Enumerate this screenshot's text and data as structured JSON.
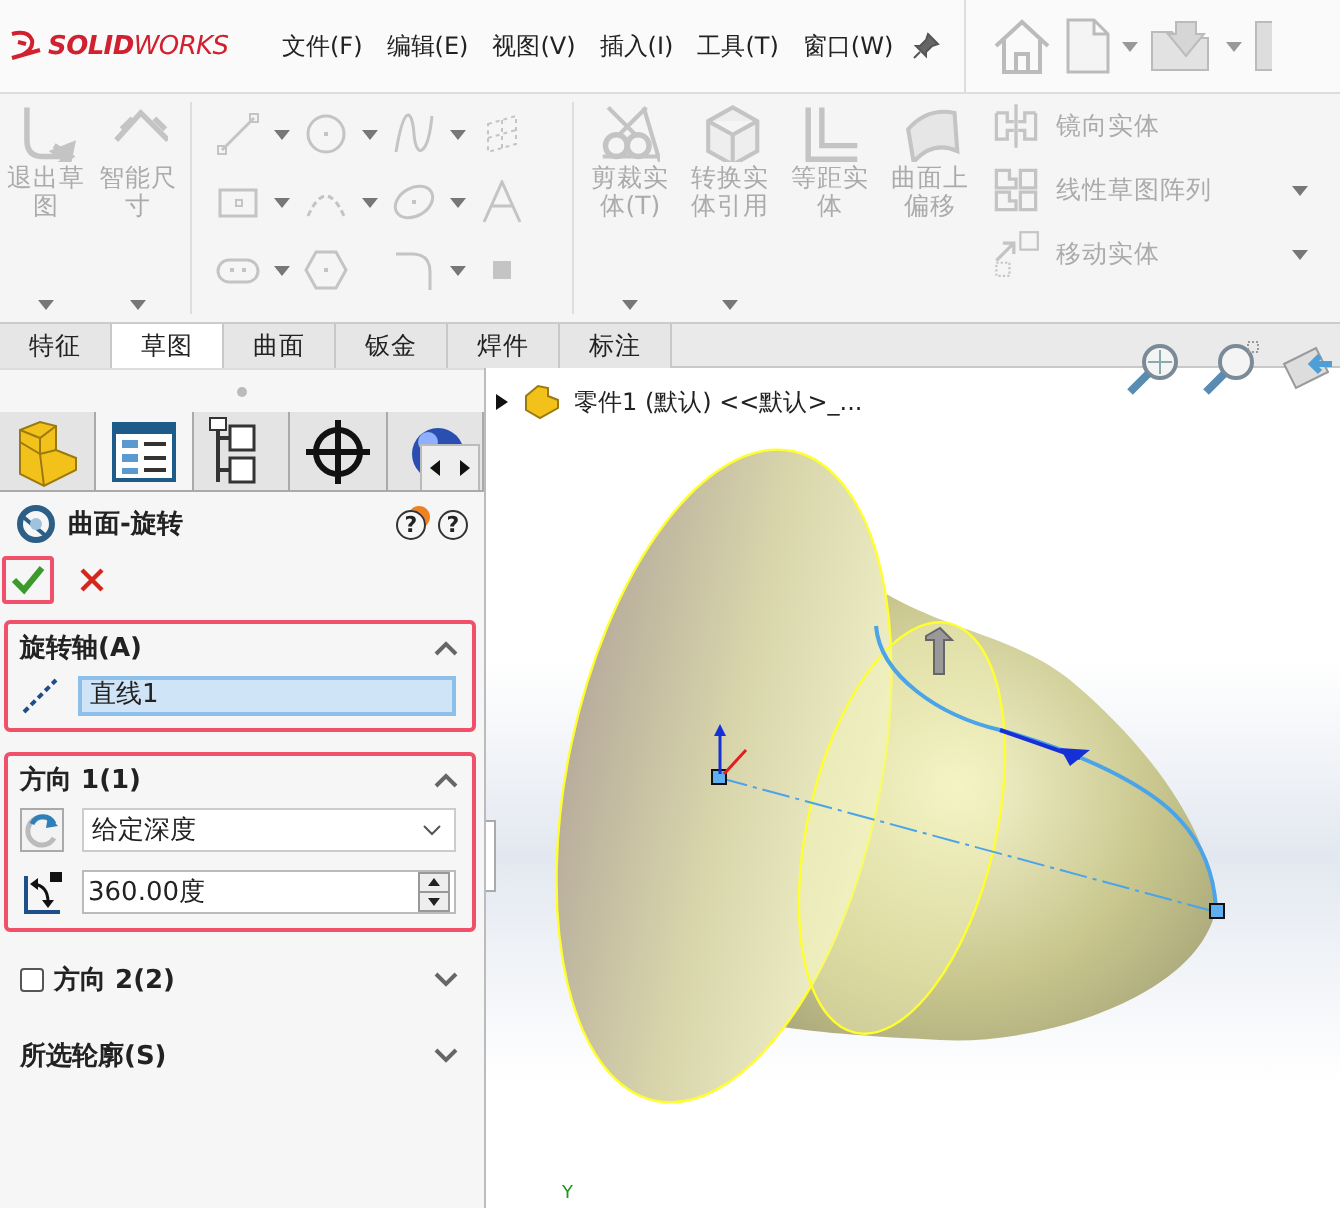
{
  "app": {
    "logo": "**SOLID**WORKS"
  },
  "menus": [
    {
      "label": "文件(F)"
    },
    {
      "label": "编辑(E)"
    },
    {
      "label": "视图(V)"
    },
    {
      "label": "插入(I)"
    },
    {
      "label": "工具(T)"
    },
    {
      "label": "窗口(W)"
    }
  ],
  "ribbon": {
    "large_buttons": [
      {
        "kind": "exit-sketch",
        "label": "退出草图",
        "disabled": true,
        "dropdown": true
      },
      {
        "kind": "smart-dimension",
        "label": "智能尺寸",
        "disabled": true,
        "dropdown": true
      }
    ],
    "sketch_tools": [
      {
        "kind": "line",
        "disabled": true,
        "dropdown": true
      },
      {
        "kind": "circle",
        "disabled": true,
        "dropdown": true
      },
      {
        "kind": "spline",
        "disabled": true,
        "dropdown": true
      },
      {
        "kind": "plane-grid",
        "disabled": true,
        "dropdown": false
      },
      {
        "kind": "rectangle",
        "disabled": true,
        "dropdown": true
      },
      {
        "kind": "arc",
        "disabled": true,
        "dropdown": true
      },
      {
        "kind": "ellipse",
        "disabled": true,
        "dropdown": true
      },
      {
        "kind": "text",
        "disabled": true,
        "dropdown": false
      },
      {
        "kind": "slot",
        "disabled": true,
        "dropdown": true
      },
      {
        "kind": "polygon",
        "disabled": true,
        "dropdown": false
      },
      {
        "kind": "fillet",
        "disabled": true,
        "dropdown": true
      },
      {
        "kind": "point",
        "disabled": true,
        "dropdown": false
      }
    ],
    "edit_buttons": [
      {
        "kind": "trim",
        "label": "剪裁实体(T)",
        "disabled": true,
        "dropdown": true
      },
      {
        "kind": "convert",
        "label": "转换实体引用",
        "disabled": true,
        "dropdown": true
      },
      {
        "kind": "offset",
        "label": "等距实体",
        "disabled": true,
        "dropdown": false
      },
      {
        "kind": "surface-offset",
        "label": "曲面上偏移",
        "disabled": true,
        "dropdown": false
      }
    ],
    "side_buttons": [
      {
        "kind": "mirror",
        "label": "镜向实体",
        "disabled": true,
        "dropdown": false
      },
      {
        "kind": "pattern",
        "label": "线性草图阵列",
        "disabled": true,
        "dropdown": true
      },
      {
        "kind": "move",
        "label": "移动实体",
        "disabled": true,
        "dropdown": true
      }
    ]
  },
  "command_tabs": [
    {
      "label": "特征",
      "selected": false
    },
    {
      "label": "草图",
      "selected": true
    },
    {
      "label": "曲面",
      "selected": false
    },
    {
      "label": "钣金",
      "selected": false
    },
    {
      "label": "焊件",
      "selected": false
    },
    {
      "label": "标注",
      "selected": false
    }
  ],
  "panel": {
    "tabs": [
      {
        "kind": "feature-tree",
        "selected": false
      },
      {
        "kind": "property",
        "selected": true
      },
      {
        "kind": "config",
        "selected": false
      },
      {
        "kind": "dimxpert",
        "selected": false
      },
      {
        "kind": "display",
        "selected": false
      }
    ],
    "title": "曲面-旋转",
    "help_buttons": [
      {
        "kind": "whats-new",
        "glyph": "?"
      },
      {
        "kind": "help",
        "glyph": "?"
      }
    ],
    "confirm": {
      "highlighted": true
    },
    "groups": [
      {
        "kind": "axis",
        "title": "旋转轴(A)",
        "expanded": true,
        "highlighted": true,
        "field": {
          "value": "直线1"
        }
      },
      {
        "kind": "direction",
        "title": "方向 1(1)",
        "expanded": true,
        "highlighted": true,
        "type": {
          "value": "给定深度"
        },
        "angle": {
          "value": "360.00度"
        }
      },
      {
        "kind": "optional",
        "title": "方向 2(2)",
        "expanded": false,
        "highlighted": false,
        "checked": false
      },
      {
        "kind": "plain",
        "title": "所选轮廓(S)",
        "expanded": false,
        "highlighted": false
      }
    ]
  },
  "viewport": {
    "tree": {
      "label": "零件1 (默认) <<默认>_..."
    },
    "axis_label": "Y"
  }
}
